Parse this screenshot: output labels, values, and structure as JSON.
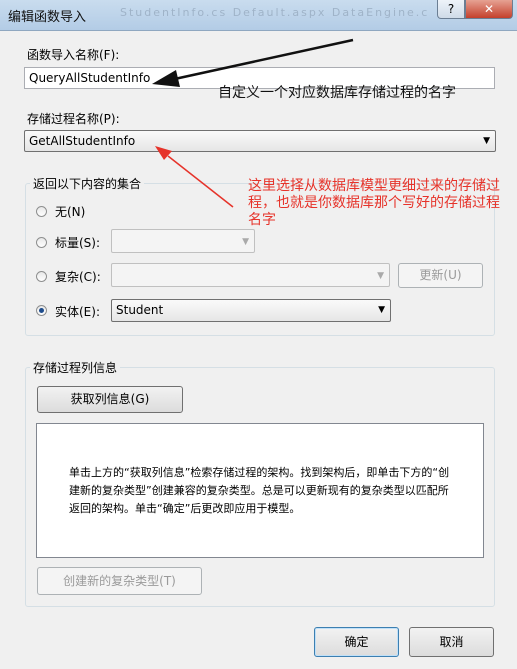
{
  "window": {
    "title": "编辑函数导入",
    "faded_tabs": "StudentInfo.cs   Default.aspx   DataEngine.cs   Test.aspx",
    "help_label": "?",
    "close_label": "✕"
  },
  "function_name": {
    "label": "函数导入名称(F):",
    "value": "QueryAllStudentInfo"
  },
  "stored_procedure": {
    "label": "存储过程名称(P):",
    "value": "GetAllStudentInfo"
  },
  "return_group": {
    "title": "返回以下内容的集合",
    "options": [
      {
        "label": "无(N)"
      },
      {
        "label": "标量(S):"
      },
      {
        "label": "复杂(C):"
      },
      {
        "label": "实体(E):",
        "value": "Student"
      }
    ],
    "update_button": "更新(U)"
  },
  "columns_group": {
    "title": "存储过程列信息",
    "get_columns_button": "获取列信息(G)",
    "info_text": "单击上方的“获取列信息”检索存储过程的架构。找到架构后，即单击下方的“创建新的复杂类型”创建兼容的复杂类型。总是可以更新现有的复杂类型以匹配所返回的架构。单击“确定”后更改即应用于模型。",
    "create_complex_button": "创建新的复杂类型(T)"
  },
  "footer": {
    "ok_button": "确定",
    "cancel_button": "取消"
  },
  "annotations": {
    "note1": "自定义一个对应数据库存储过程的名字",
    "note2": "这里选择从数据库模型更细过来的存储过程，也就是你数据库那个写好的存储过程名字"
  },
  "colors": {
    "annotation_red": "#e6332a",
    "annotation_black": "#111111"
  }
}
